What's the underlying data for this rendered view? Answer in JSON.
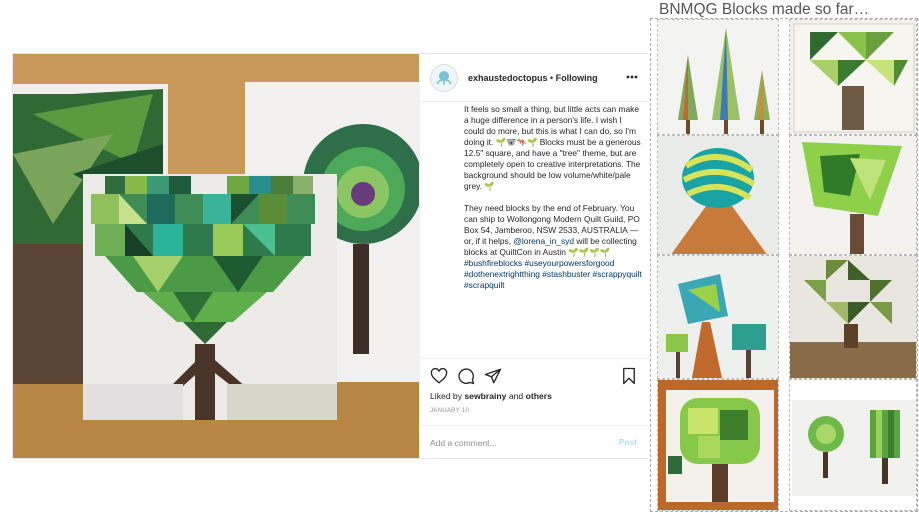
{
  "post": {
    "username": "exhaustedoctopus",
    "separator": " • ",
    "follow_status": "Following",
    "caption_p1": "It feels so small a thing, but little acts can make a huge difference in a person's life. I wish I could do more, but this is what I can do, so I'm doing it. 🌱🐨🦘🌱 Blocks must be a generous 12.5\" square, and have a \"tree\" theme, but are completely open to creative interpretations. The background should be low volume/white/pale grey. 🌱",
    "caption_p2_a": "They need blocks by the end of February. You can ship to Wollongong Modern Quilt Guild, PO Box 54, Jamberoo, NSW 2533, AUSTRALIA — or, if it helps, ",
    "caption_p2_mention": "@lorena_in_syd",
    "caption_p2_b": " will be collecting blocks at QuiltCon in Austin 🌱🌱🌱🌱 ",
    "hashtags": "#bushfireblocks #useyourpowersforgood #dothenextrightthing #stashbuster #scrappyquilt #scrapquilt",
    "liked_by_prefix": "Liked by ",
    "liked_by_user": "sewbrainy",
    "liked_by_and": " and ",
    "liked_by_others": "others",
    "date": "JANUARY 10",
    "comment_placeholder": "Add a comment...",
    "post_button": "Post"
  },
  "collage": {
    "title": "BNMQG Blocks made so far…"
  },
  "colors": {
    "link": "#00376b",
    "post_button": "#b2dffc",
    "muted": "#8e8e8e",
    "border": "#efefef"
  },
  "icons": [
    "heart-icon",
    "comment-icon",
    "share-icon",
    "bookmark-icon",
    "more-options-icon"
  ]
}
